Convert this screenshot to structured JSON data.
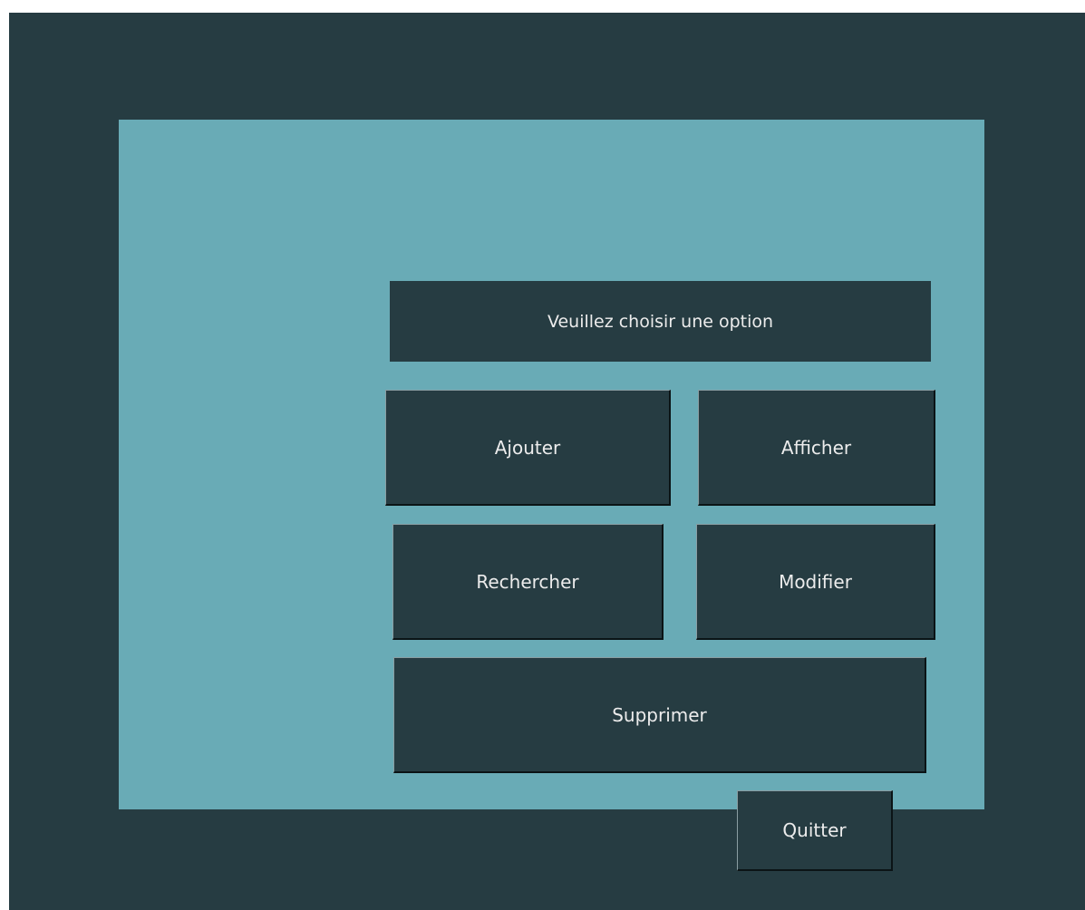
{
  "header": {
    "title": "Veuillez choisir une option"
  },
  "buttons": {
    "ajouter": "Ajouter",
    "afficher": "Afficher",
    "rechercher": "Rechercher",
    "modifier": "Modifier",
    "supprimer": "Supprimer",
    "quitter": "Quitter"
  },
  "colors": {
    "background": "#263c42",
    "panel": "#69abb6",
    "button": "#263c42",
    "text": "#ececec"
  }
}
